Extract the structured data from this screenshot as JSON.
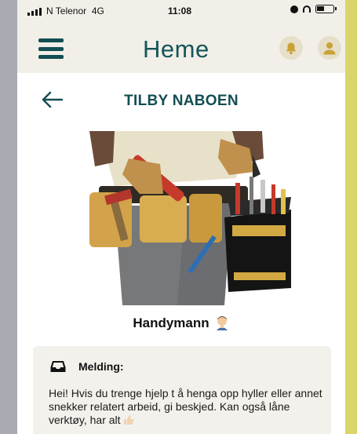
{
  "status_bar": {
    "carrier": "N Telenor",
    "network": "4G",
    "time": "11:08"
  },
  "header": {
    "logo": "Heme",
    "icons": [
      "menu-icon",
      "bell-icon",
      "user-icon"
    ]
  },
  "page": {
    "title": "TILBY NABOEN",
    "back_icon": "back-arrow-icon"
  },
  "service": {
    "name": "Handymann",
    "emoji": "mechanic-emoji",
    "image": "handyman-with-tools-photo"
  },
  "message": {
    "label": "Melding:",
    "icon": "inbox-icon",
    "text": "Hei! Hvis du trenge hjelp t å henga opp hyller eller annet snekker relatert arbeid, gi beskjed. Kan også låne verktøy, har alt"
  },
  "colors": {
    "brand": "#124e52",
    "header_bg": "#f1efe8",
    "icon_circle": "#e6dfc9",
    "accent_gold": "#c9a233"
  }
}
